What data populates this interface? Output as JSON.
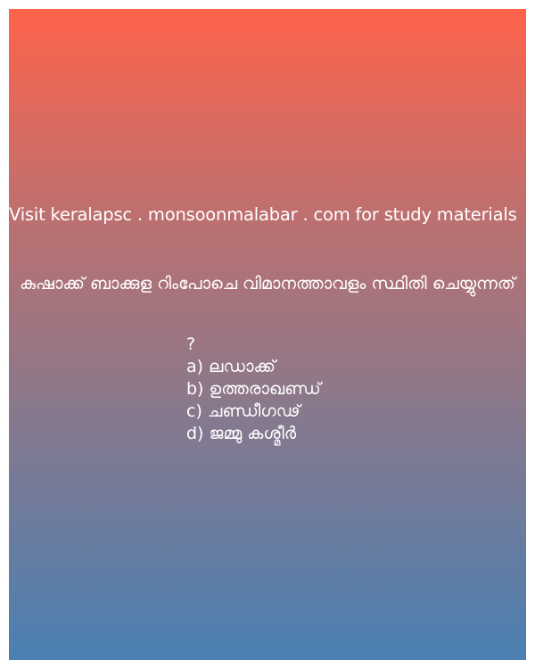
{
  "visit_text": "Visit keralapsc . monsoonmalabar . com for study materials",
  "question": "കുഷാക്ക് ബാക്കുള റിംപോചെ വിമാനത്താവളം സ്ഥിതി ചെയ്യുന്നത്",
  "question_mark": "?",
  "options": [
    "a) ലഡാക്ക്",
    "b) ഉത്തരാഖണ്ഡ്",
    "c) ചണ്ഡീഗഢ്",
    "d) ജമ്മു കശ്മീർ"
  ],
  "colors": {
    "gradient_top": "#fe634b",
    "gradient_bottom": "#4a80b2",
    "text": "#ffffff"
  }
}
